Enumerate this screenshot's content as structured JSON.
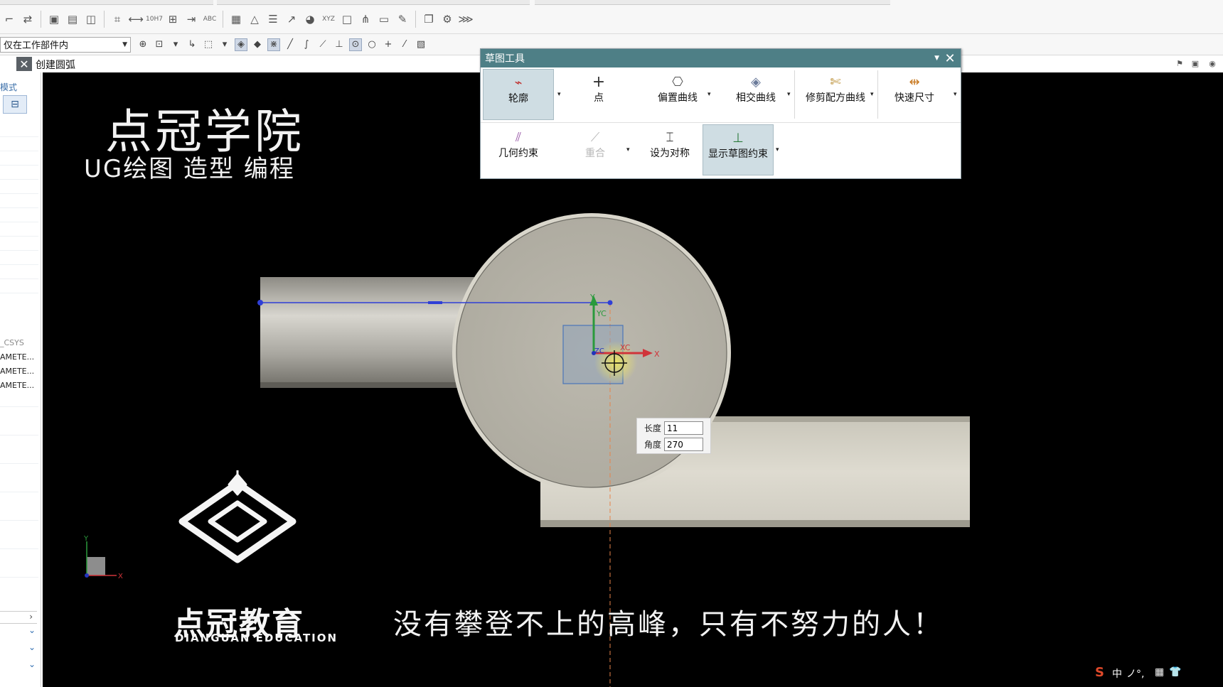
{
  "toolbar": {
    "row1_icons": [
      "trim-icon",
      "split-icon",
      "view-icon",
      "section-icon",
      "grid-icon",
      "measure-icon",
      "tolerance-icon",
      "datum-icon",
      "offset-icon",
      "dimension-icon",
      "table-icon",
      "triangle-icon",
      "note-icon",
      "arrow-icon",
      "sphere-icon",
      "xyz-icon",
      "box-icon",
      "tree-icon",
      "form-icon",
      "brush-icon",
      "paste-icon",
      "gear-icon",
      "pattern-icon"
    ],
    "row1_texts": {
      "tolerance": "10H7",
      "dimension": "ABC",
      "xyz": "XYZ"
    },
    "filter_value": "仅在工作部件内"
  },
  "command": {
    "title": "创建圆弧"
  },
  "navigator": {
    "mode_label": "模式",
    "entries": [
      "_CSYS",
      "AMETE...",
      "AMETE...",
      "AMETE..."
    ]
  },
  "brand": {
    "title": "点冠学院",
    "subtitle": "UG绘图 造型 编程",
    "logo_cn": "点冠教育",
    "logo_en": "DIANGUAN EDUCATION",
    "slogan": "没有攀登不上的高峰，只有不努力的人！"
  },
  "sketch_tools": {
    "title": "草图工具",
    "row1": [
      {
        "label": "轮廓",
        "icon": "profile-icon",
        "active": true
      },
      {
        "label": "点",
        "icon": "plus-icon",
        "active": false
      },
      {
        "label": "偏置曲线",
        "icon": "offset-curve-icon",
        "active": false
      },
      {
        "label": "相交曲线",
        "icon": "intersect-curve-icon",
        "active": false
      },
      {
        "label": "修剪配方曲线",
        "icon": "trim-recipe-icon",
        "active": false
      },
      {
        "label": "快速尺寸",
        "icon": "rapid-dimension-icon",
        "active": false
      }
    ],
    "row2": [
      {
        "label": "几何约束",
        "icon": "geometric-constraint-icon",
        "active": false,
        "disabled": false
      },
      {
        "label": "重合",
        "icon": "coincident-icon",
        "active": false,
        "disabled": true
      },
      {
        "label": "设为对称",
        "icon": "symmetric-icon",
        "active": false,
        "disabled": false
      },
      {
        "label": "显示草图约束",
        "icon": "show-constraints-icon",
        "active": true,
        "disabled": false
      }
    ]
  },
  "dimension_input": {
    "length_label": "长度",
    "length_value": "11",
    "angle_label": "角度",
    "angle_value": "270"
  },
  "axes": {
    "y": "Y",
    "yc": "YC",
    "x": "X",
    "xc": "XC",
    "zc": "ZC"
  },
  "colors": {
    "sketch_header": "#4e7f86",
    "background": "#000000",
    "sketch_line": "#2f3fd6"
  }
}
